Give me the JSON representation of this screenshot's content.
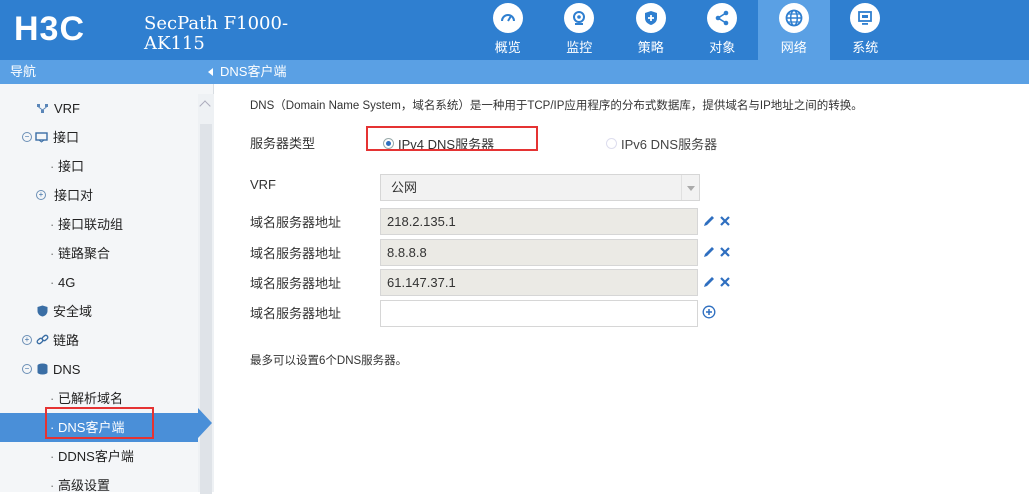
{
  "header": {
    "product_line1": "SecPath F1000-",
    "product_line2": "AK115",
    "nav": [
      {
        "label": "概览",
        "icon": "gauge-icon"
      },
      {
        "label": "监控",
        "icon": "camera-icon"
      },
      {
        "label": "策略",
        "icon": "shield-plus-icon"
      },
      {
        "label": "对象",
        "icon": "share-icon"
      },
      {
        "label": "网络",
        "icon": "globe-icon",
        "active": true
      },
      {
        "label": "系统",
        "icon": "monitor-icon"
      }
    ]
  },
  "sidebar": {
    "title": "导航",
    "items": [
      {
        "label": "VRF",
        "level": 1
      },
      {
        "label": "接口",
        "level": 0
      },
      {
        "label": "接口",
        "level": 2
      },
      {
        "label": "接口对",
        "level": 1
      },
      {
        "label": "接口联动组",
        "level": 2
      },
      {
        "label": "链路聚合",
        "level": 2
      },
      {
        "label": "4G",
        "level": 2
      },
      {
        "label": "安全域",
        "level": 1
      },
      {
        "label": "链路",
        "level": 0
      },
      {
        "label": "DNS",
        "level": 0
      },
      {
        "label": "已解析域名",
        "level": 2
      },
      {
        "label": "DNS客户端",
        "level": 2,
        "active": true
      },
      {
        "label": "DDNS客户端",
        "level": 2
      },
      {
        "label": "高级设置",
        "level": 2
      }
    ]
  },
  "main": {
    "breadcrumb": "DNS客户端",
    "description": "DNS（Domain Name System，域名系统）是一种用于TCP/IP应用程序的分布式数据库，提供域名与IP地址之间的转换。",
    "server_type_label": "服务器类型",
    "ipv4_option": "IPv4 DNS服务器",
    "ipv6_option": "IPv6 DNS服务器",
    "vrf_label": "VRF",
    "vrf_value": "公网",
    "server_label": "域名服务器地址",
    "servers": [
      "218.2.135.1",
      "8.8.8.8",
      "61.147.37.1",
      ""
    ],
    "note": "最多可以设置6个DNS服务器。"
  },
  "colors": {
    "header_bg": "#2f7fd0",
    "active_tab": "#5aa0e4",
    "highlight_box": "#e53333"
  }
}
